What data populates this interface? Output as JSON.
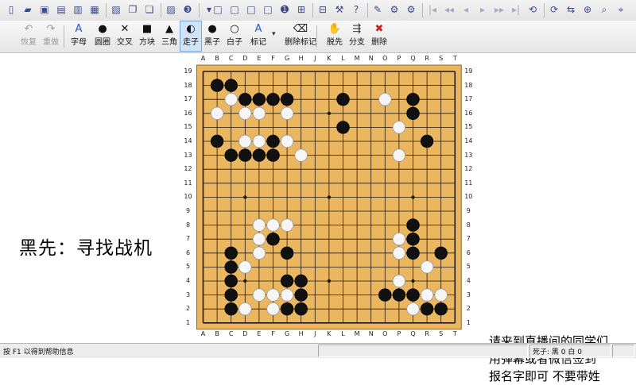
{
  "toolbar_main": {
    "icons": [
      "new-file-icon",
      "open-folder-icon",
      "save-icon",
      "save-as-icon",
      "print-icon",
      "print-preview-icon",
      "image-export-icon",
      "copy-icon",
      "paste-icon",
      "library-icon",
      "stone-color-icon",
      "dropdown-arrow-icon",
      "board-view-1-icon",
      "board-view-2-icon",
      "board-view-3-icon",
      "board-view-4-icon",
      "move-number-icon",
      "grid-view-icon",
      "tree-view-icon",
      "tools-icon",
      "question-icon",
      "brush-icon",
      "settings-icon",
      "gear-icon",
      "first-move-icon",
      "prev-branch-icon",
      "prev-move-icon",
      "next-move-icon",
      "next-branch-icon",
      "last-move-icon",
      "rotate-left-icon",
      "rotate-right-icon",
      "flip-icon",
      "zoom-icon",
      "search-icon",
      "find-icon"
    ]
  },
  "toolbar_edit": {
    "buttons": [
      {
        "key": "undo",
        "label": "恢复",
        "icon": "↶",
        "enabled": false
      },
      {
        "key": "redo",
        "label": "重做",
        "icon": "↷",
        "enabled": false
      },
      {
        "key": "letter",
        "label": "字母",
        "icon": "A",
        "enabled": true
      },
      {
        "key": "circle",
        "label": "圆圈",
        "icon": "●",
        "enabled": true
      },
      {
        "key": "cross",
        "label": "交叉",
        "icon": "✕",
        "enabled": true
      },
      {
        "key": "square",
        "label": "方块",
        "icon": "■",
        "enabled": true
      },
      {
        "key": "triangle",
        "label": "三角",
        "icon": "▲",
        "enabled": true
      },
      {
        "key": "move",
        "label": "走子",
        "icon": "◐",
        "enabled": true,
        "active": true
      },
      {
        "key": "black",
        "label": "黑子",
        "icon": "●",
        "enabled": true
      },
      {
        "key": "white",
        "label": "白子",
        "icon": "○",
        "enabled": true
      },
      {
        "key": "mark",
        "label": "标记",
        "icon": "A",
        "enabled": true
      },
      {
        "key": "erase_marks",
        "label": "删除标记",
        "icon": "⌫",
        "enabled": true
      },
      {
        "key": "pass",
        "label": "脱先",
        "icon": "✋",
        "enabled": true
      },
      {
        "key": "branch",
        "label": "分支",
        "icon": "⇶",
        "enabled": true
      },
      {
        "key": "delete",
        "label": "删除",
        "icon": "✖",
        "enabled": true
      }
    ]
  },
  "board": {
    "size": 19,
    "col_labels": [
      "A",
      "B",
      "C",
      "D",
      "E",
      "F",
      "G",
      "H",
      "J",
      "K",
      "L",
      "M",
      "N",
      "O",
      "P",
      "Q",
      "R",
      "S",
      "T"
    ],
    "row_labels": [
      "19",
      "18",
      "17",
      "16",
      "15",
      "14",
      "13",
      "12",
      "11",
      "10",
      "9",
      "8",
      "7",
      "6",
      "5",
      "4",
      "3",
      "2",
      "1"
    ],
    "stones": [
      {
        "c": "B",
        "p": "B18"
      },
      {
        "c": "B",
        "p": "C18"
      },
      {
        "c": "W",
        "p": "C17"
      },
      {
        "c": "B",
        "p": "D17"
      },
      {
        "c": "B",
        "p": "E17"
      },
      {
        "c": "B",
        "p": "F17"
      },
      {
        "c": "B",
        "p": "G17"
      },
      {
        "c": "W",
        "p": "B16"
      },
      {
        "c": "W",
        "p": "D16"
      },
      {
        "c": "W",
        "p": "E16"
      },
      {
        "c": "W",
        "p": "G16"
      },
      {
        "c": "B",
        "p": "B14"
      },
      {
        "c": "W",
        "p": "D14"
      },
      {
        "c": "W",
        "p": "E14"
      },
      {
        "c": "B",
        "p": "F14"
      },
      {
        "c": "W",
        "p": "G14"
      },
      {
        "c": "B",
        "p": "C13"
      },
      {
        "c": "B",
        "p": "D13"
      },
      {
        "c": "B",
        "p": "E13"
      },
      {
        "c": "B",
        "p": "F13"
      },
      {
        "c": "W",
        "p": "H13"
      },
      {
        "c": "B",
        "p": "L17"
      },
      {
        "c": "B",
        "p": "L15"
      },
      {
        "c": "W",
        "p": "O17"
      },
      {
        "c": "B",
        "p": "Q17"
      },
      {
        "c": "B",
        "p": "Q16"
      },
      {
        "c": "W",
        "p": "P15"
      },
      {
        "c": "B",
        "p": "R14"
      },
      {
        "c": "W",
        "p": "P13"
      },
      {
        "c": "W",
        "p": "E8"
      },
      {
        "c": "W",
        "p": "F8"
      },
      {
        "c": "W",
        "p": "G8"
      },
      {
        "c": "W",
        "p": "E7"
      },
      {
        "c": "B",
        "p": "F7"
      },
      {
        "c": "W",
        "p": "E6"
      },
      {
        "c": "B",
        "p": "G6"
      },
      {
        "c": "B",
        "p": "C6"
      },
      {
        "c": "B",
        "p": "C5"
      },
      {
        "c": "W",
        "p": "D5"
      },
      {
        "c": "B",
        "p": "C4"
      },
      {
        "c": "B",
        "p": "G4"
      },
      {
        "c": "B",
        "p": "H4"
      },
      {
        "c": "B",
        "p": "C3"
      },
      {
        "c": "W",
        "p": "E3"
      },
      {
        "c": "W",
        "p": "F3"
      },
      {
        "c": "W",
        "p": "G3"
      },
      {
        "c": "B",
        "p": "H3"
      },
      {
        "c": "B",
        "p": "C2"
      },
      {
        "c": "W",
        "p": "D2"
      },
      {
        "c": "W",
        "p": "F2"
      },
      {
        "c": "B",
        "p": "G2"
      },
      {
        "c": "B",
        "p": "H2"
      },
      {
        "c": "B",
        "p": "Q8"
      },
      {
        "c": "W",
        "p": "P7"
      },
      {
        "c": "B",
        "p": "Q7"
      },
      {
        "c": "W",
        "p": "P6"
      },
      {
        "c": "B",
        "p": "Q6"
      },
      {
        "c": "B",
        "p": "S6"
      },
      {
        "c": "W",
        "p": "R5"
      },
      {
        "c": "W",
        "p": "P4"
      },
      {
        "c": "B",
        "p": "O3"
      },
      {
        "c": "B",
        "p": "P3"
      },
      {
        "c": "B",
        "p": "Q3"
      },
      {
        "c": "W",
        "p": "R3"
      },
      {
        "c": "W",
        "p": "S3"
      },
      {
        "c": "W",
        "p": "Q2"
      },
      {
        "c": "B",
        "p": "R2"
      },
      {
        "c": "B",
        "p": "S2"
      }
    ],
    "colors": {
      "wood": "#ebb660",
      "line": "#1f1a10",
      "black": "#111111",
      "white": "#f6f6f6"
    }
  },
  "problem_text": "黑先：寻找战机",
  "notice": {
    "line1": "请来到直播间的同学们",
    "line2": "用弹幕或者微信签到",
    "line3": "报名字即可 不要带姓"
  },
  "status": {
    "hint": "按 F1 以得到帮助信息",
    "captures": "死子: 黑 0 白 0"
  }
}
